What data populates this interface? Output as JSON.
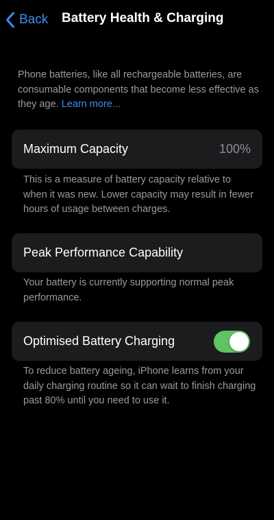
{
  "nav": {
    "back_label": "Back",
    "title": "Battery Health & Charging"
  },
  "intro": {
    "text": "Phone batteries, like all rechargeable batteries, are consumable components that become less effective as they age. ",
    "link": "Learn more..."
  },
  "maximum_capacity": {
    "label": "Maximum Capacity",
    "value": "100%",
    "description": "This is a measure of battery capacity relative to when it was new. Lower capacity may result in fewer hours of usage between charges."
  },
  "peak_performance": {
    "label": "Peak Performance Capability",
    "description": "Your battery is currently supporting normal peak performance."
  },
  "optimised_charging": {
    "label": "Optimised Battery Charging",
    "enabled": true,
    "description": "To reduce battery ageing, iPhone learns from your daily charging routine so it can wait to finish charging past 80% until you need to use it."
  },
  "colors": {
    "background": "#000000",
    "card": "#1c1c1e",
    "accent_link": "#3d8ef0",
    "toggle_on": "#5fc464",
    "secondary_text": "#9b9ba1"
  },
  "icons": {
    "back": "chevron-left-icon"
  }
}
